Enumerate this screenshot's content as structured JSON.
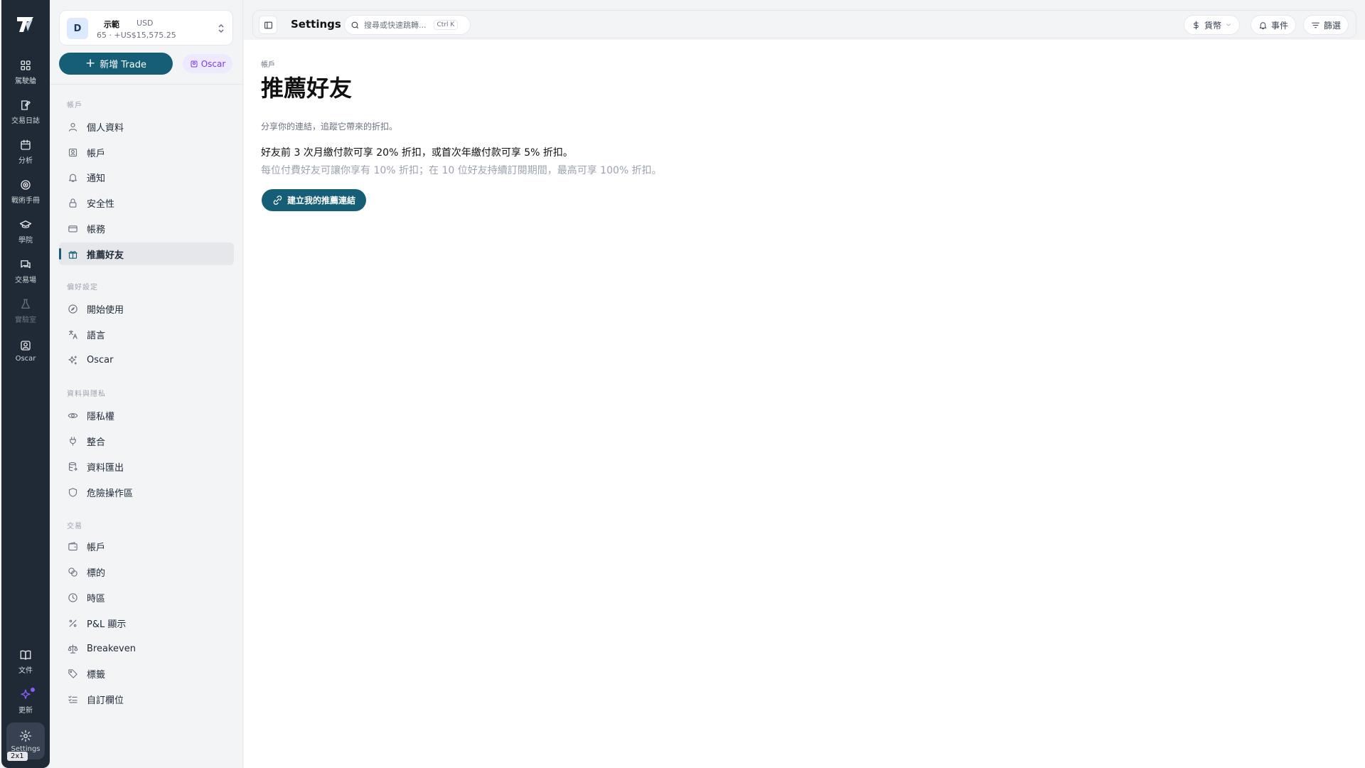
{
  "rail": {
    "items": [
      {
        "label": "駕駛艙",
        "icon": "dashboard-icon"
      },
      {
        "label": "交易日誌",
        "icon": "journal-icon"
      },
      {
        "label": "分析",
        "icon": "calendar-icon"
      },
      {
        "label": "戰術手冊",
        "icon": "target-icon"
      },
      {
        "label": "學院",
        "icon": "graduation-cap-icon"
      },
      {
        "label": "交易場",
        "icon": "chat-icon"
      },
      {
        "label": "實驗室",
        "icon": "flask-icon"
      },
      {
        "label": "Oscar",
        "icon": "oscar-icon"
      }
    ],
    "bottom": [
      {
        "label": "文件",
        "icon": "book-icon"
      },
      {
        "label": "更新",
        "icon": "sparkle-icon"
      },
      {
        "label": "Settings",
        "icon": "gear-icon"
      }
    ],
    "size_badge": "2x1"
  },
  "account": {
    "avatar": "D",
    "name": "示範",
    "currency": "USD",
    "balance": "65 · +US$15,575.25"
  },
  "actions": {
    "new_trade": "新增 Trade",
    "oscar": "Oscar"
  },
  "sidebar": {
    "sections": [
      {
        "title": "帳戶",
        "items": [
          {
            "label": "個人資料",
            "icon": "user-icon"
          },
          {
            "label": "帳戶",
            "icon": "id-card-icon"
          },
          {
            "label": "通知",
            "icon": "bell-icon"
          },
          {
            "label": "安全性",
            "icon": "lock-icon"
          },
          {
            "label": "帳務",
            "icon": "credit-card-icon"
          },
          {
            "label": "推薦好友",
            "icon": "gift-icon",
            "active": true
          }
        ]
      },
      {
        "title": "偏好設定",
        "items": [
          {
            "label": "開始使用",
            "icon": "compass-icon"
          },
          {
            "label": "語言",
            "icon": "translate-icon"
          },
          {
            "label": "Oscar",
            "icon": "sparkles-icon"
          }
        ]
      },
      {
        "title": "資料與隱私",
        "items": [
          {
            "label": "隱私權",
            "icon": "eye-icon"
          },
          {
            "label": "整合",
            "icon": "plug-icon"
          },
          {
            "label": "資料匯出",
            "icon": "database-export-icon"
          },
          {
            "label": "危險操作區",
            "icon": "shield-icon"
          }
        ]
      },
      {
        "title": "交易",
        "items": [
          {
            "label": "帳戶",
            "icon": "wallet-icon"
          },
          {
            "label": "標的",
            "icon": "coins-icon"
          },
          {
            "label": "時區",
            "icon": "clock-icon"
          },
          {
            "label": "P&L 顯示",
            "icon": "percent-icon"
          },
          {
            "label": "Breakeven",
            "icon": "scale-icon"
          },
          {
            "label": "標籤",
            "icon": "tag-icon"
          },
          {
            "label": "自訂欄位",
            "icon": "list-check-icon"
          }
        ]
      }
    ]
  },
  "topbar": {
    "title": "Settings",
    "search_placeholder": "搜尋或快速跳轉...",
    "search_shortcut": "Ctrl K",
    "currency": "貨幣",
    "events": "事件",
    "filter": "篩選"
  },
  "page": {
    "breadcrumb": "帳戶",
    "title": "推薦好友",
    "subtitle": "分享你的連結，追蹤它帶來的折扣。",
    "promo_main": "好友前 3 次月繳付款可享 20% 折扣，或首次年繳付款可享 5% 折扣。",
    "promo_sub": "每位付費好友可讓你享有 10% 折扣；在 10 位好友持續訂閱期間，最高可享 100% 折扣。",
    "cta": "建立我的推薦連結"
  },
  "colors": {
    "rail_bg": "#1f2a36",
    "accent": "#155e75",
    "oscar_purple": "#7c3aed"
  }
}
